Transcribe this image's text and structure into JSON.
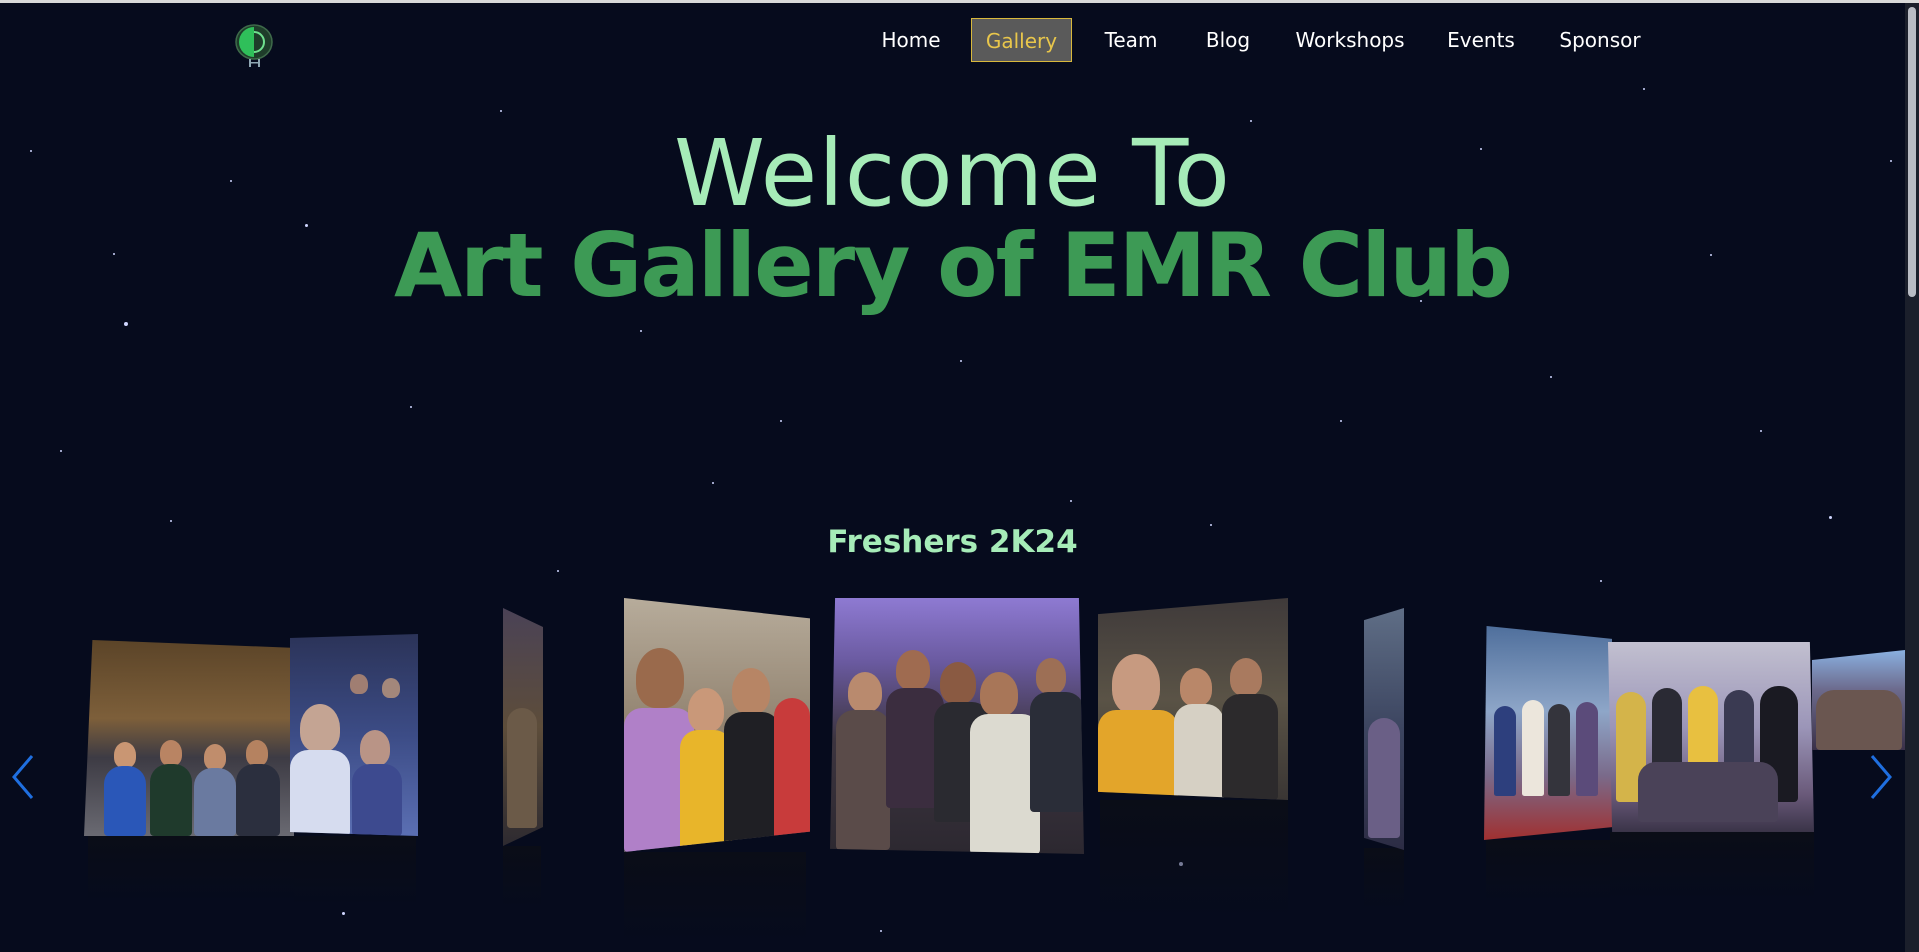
{
  "nav": {
    "logo_icon": "emr-club-logo-icon",
    "items": [
      {
        "label": "Home"
      },
      {
        "label": "Gallery"
      },
      {
        "label": "Team"
      },
      {
        "label": "Blog"
      },
      {
        "label": "Workshops"
      },
      {
        "label": "Events"
      },
      {
        "label": "Sponsor"
      }
    ],
    "active_item": "Gallery"
  },
  "hero": {
    "line1": "Welcome To",
    "line2": "Art Gallery of EMR Club"
  },
  "gallery": {
    "section_title": "Freshers 2K24",
    "prev_icon": "chevron-left-icon",
    "next_icon": "chevron-right-icon",
    "photo_count": 11
  },
  "colors": {
    "background": "#060b1d",
    "hero_light_green": "#a6ecb8",
    "hero_dark_green": "#3d9a55",
    "active_nav_text": "#e8c64b",
    "arrow_blue": "#1f6fe0"
  }
}
